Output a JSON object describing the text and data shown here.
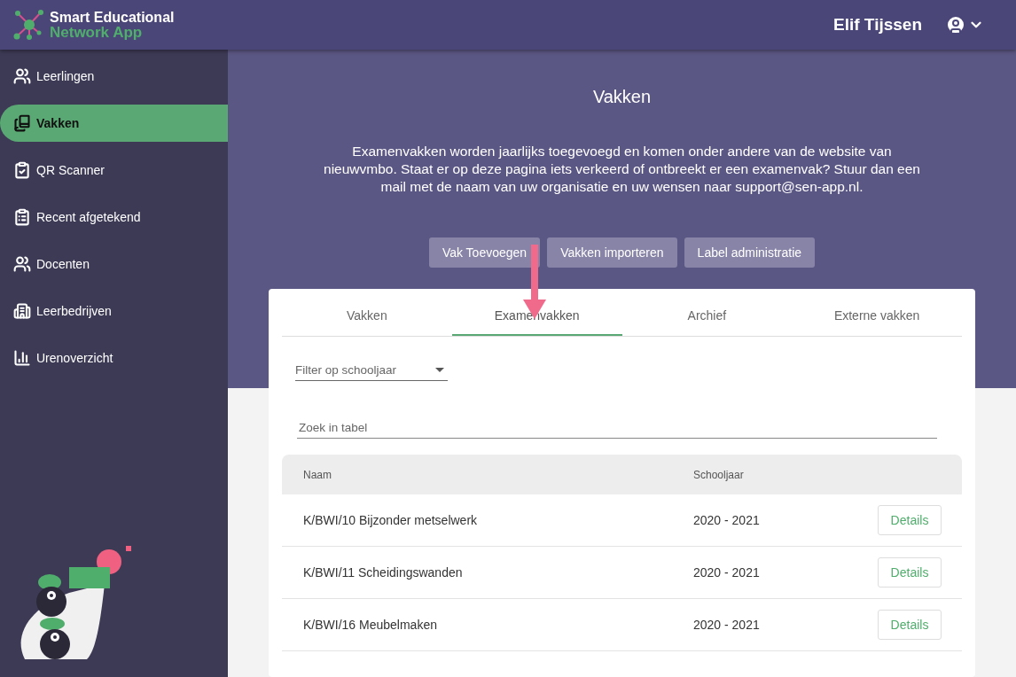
{
  "header": {
    "app_name_line1": "Smart Educational",
    "app_name_line2": "Network App",
    "user_name": "Elif Tijssen"
  },
  "sidebar": {
    "items": [
      {
        "label": "Leerlingen",
        "selected": false
      },
      {
        "label": "Vakken",
        "selected": true
      },
      {
        "label": "QR Scanner",
        "selected": false
      },
      {
        "label": "Recent afgetekend",
        "selected": false
      },
      {
        "label": "Docenten",
        "selected": false
      },
      {
        "label": "Leerbedrijven",
        "selected": false
      },
      {
        "label": "Urenoverzicht",
        "selected": false
      }
    ]
  },
  "page": {
    "title": "Vakken",
    "description": "Examenvakken worden jaarlijks toegevoegd en komen onder andere van de website van nieuwvmbo. Staat er op deze pagina iets verkeerd of ontbreekt er een examenvak? Stuur dan een mail met de naam van uw organisatie en uw wensen naar support@sen-app.nl.",
    "buttons": [
      "Vak Toevoegen",
      "Vakken importeren",
      "Label administratie"
    ]
  },
  "tabs": [
    {
      "label": "Vakken",
      "selected": false
    },
    {
      "label": "Examenvakken",
      "selected": true
    },
    {
      "label": "Archief",
      "selected": false
    },
    {
      "label": "Externe vakken",
      "selected": false
    }
  ],
  "filter": {
    "placeholder": "Filter op schooljaar"
  },
  "search": {
    "placeholder": "Zoek in tabel"
  },
  "table": {
    "columns": [
      "Naam",
      "Schooljaar"
    ],
    "rows": [
      {
        "naam": "K/BWI/10 Bijzonder metselwerk",
        "schooljaar": "2020 - 2021",
        "action": "Details"
      },
      {
        "naam": "K/BWI/11 Scheidingswanden",
        "schooljaar": "2020 - 2021",
        "action": "Details"
      },
      {
        "naam": "K/BWI/16 Meubelmaken",
        "schooljaar": "2020 - 2021",
        "action": "Details"
      }
    ]
  }
}
